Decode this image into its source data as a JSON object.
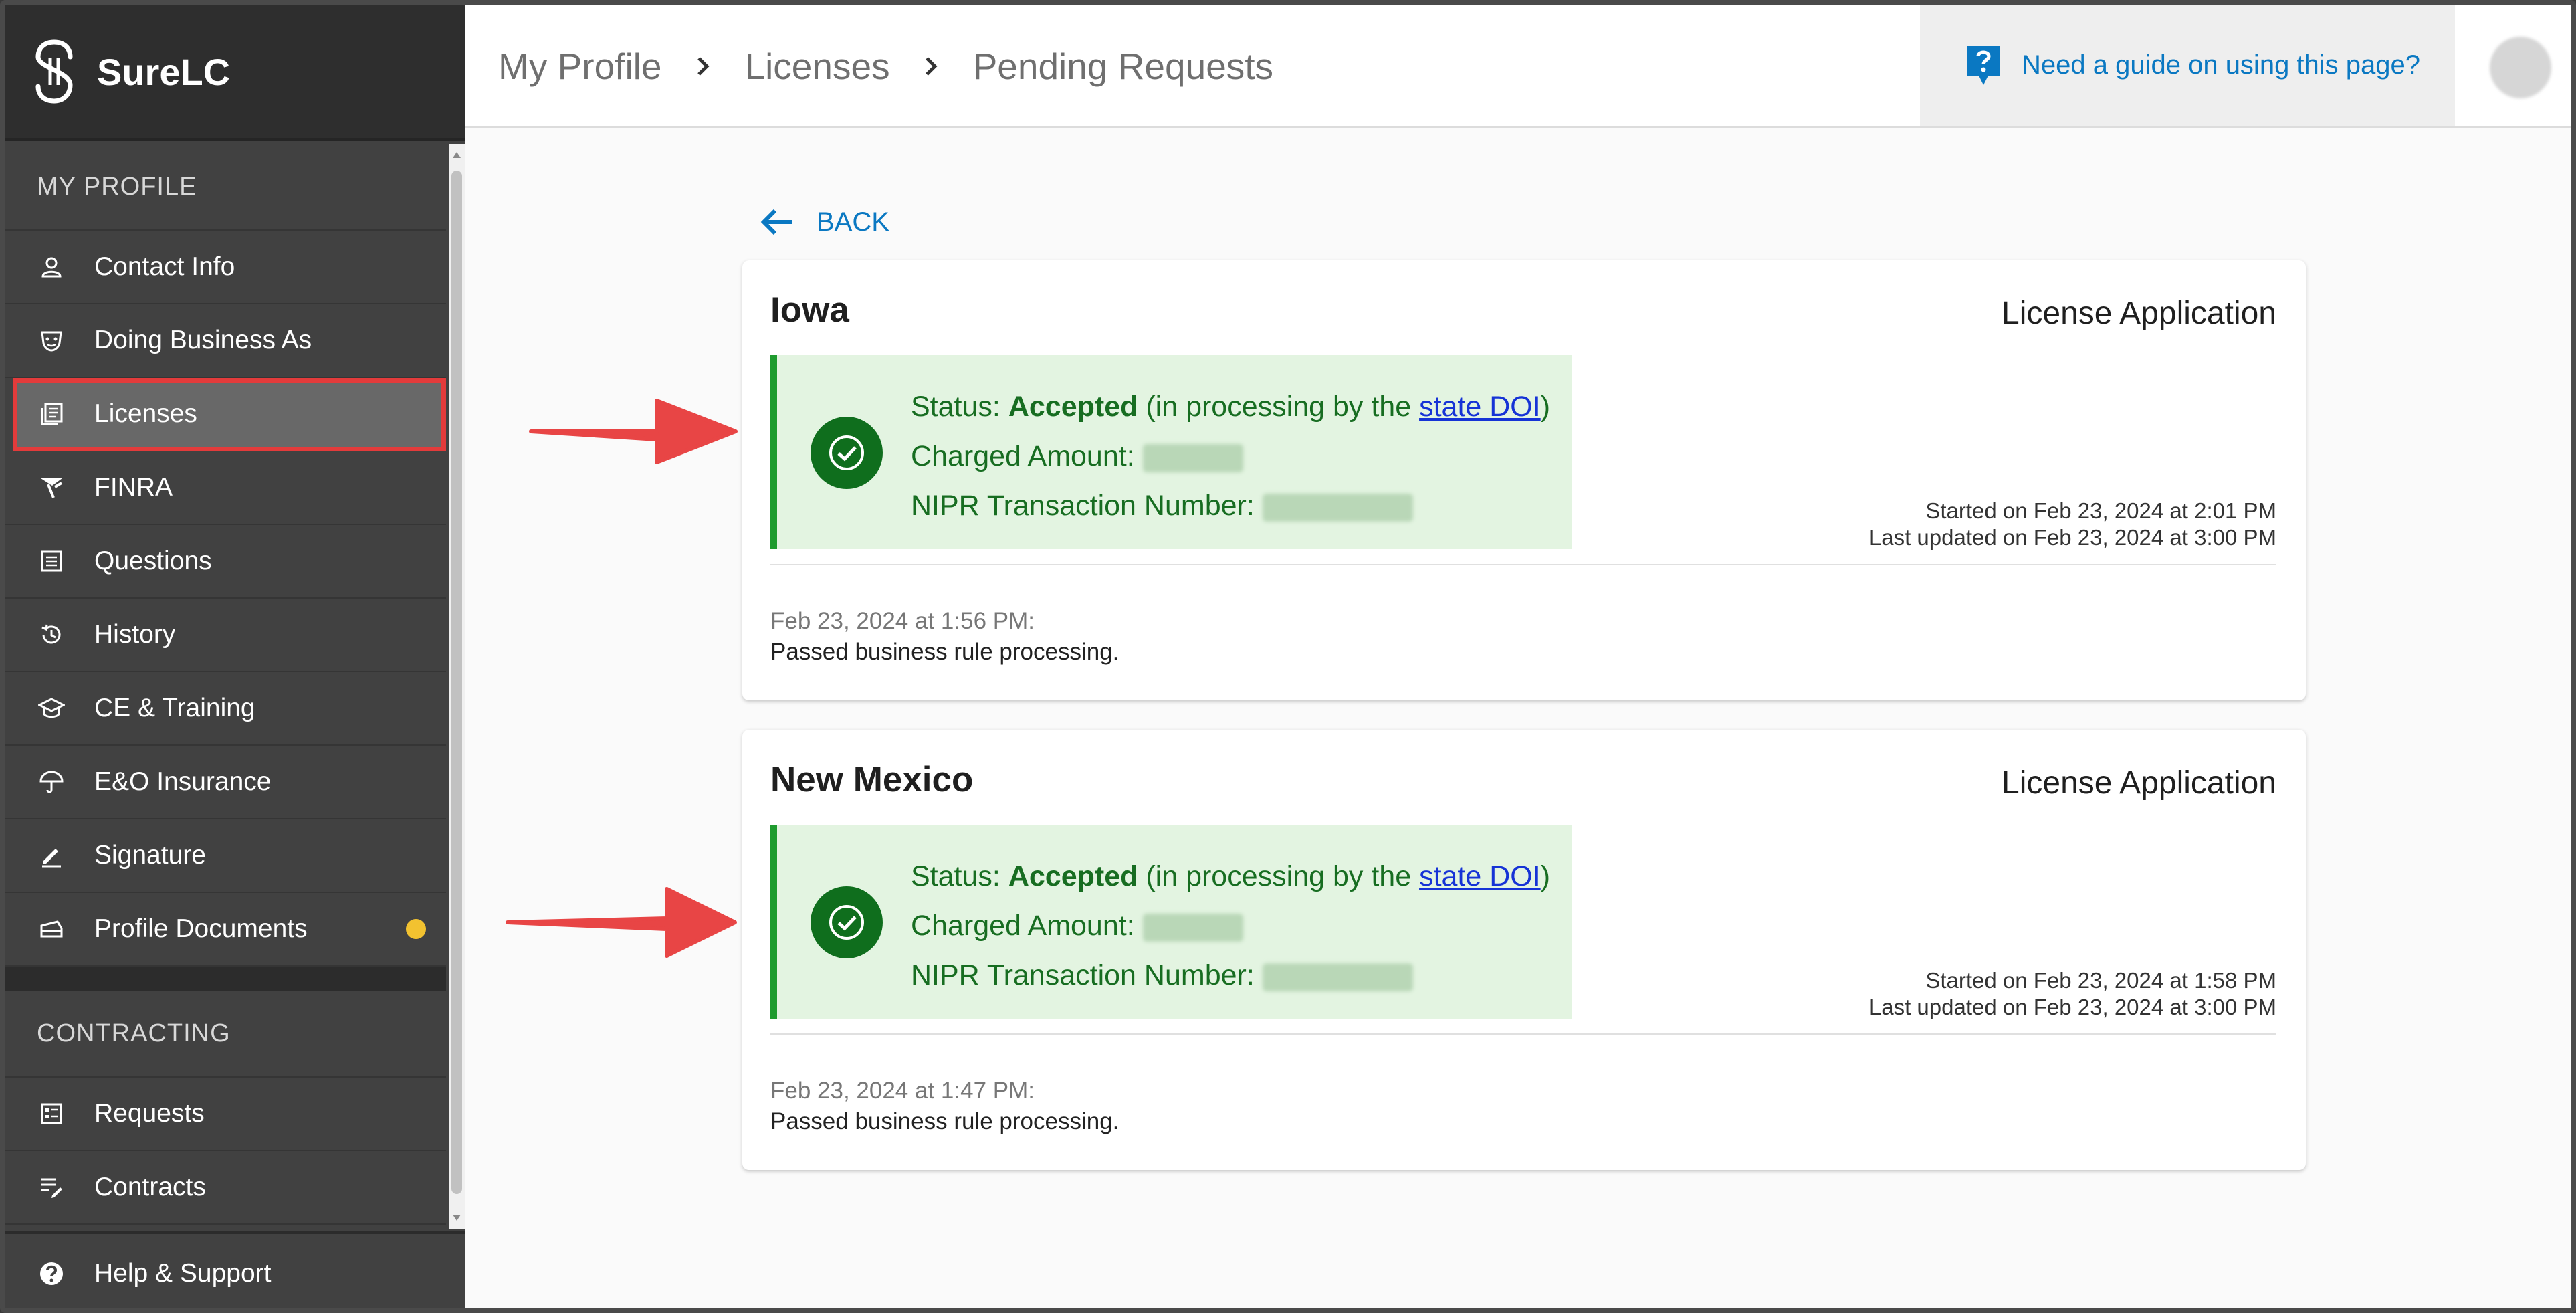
{
  "app": {
    "name": "SureLC"
  },
  "sidebar": {
    "sections": [
      {
        "title": "MY PROFILE",
        "items": [
          {
            "label": "Contact Info",
            "icon": "person-icon"
          },
          {
            "label": "Doing Business As",
            "icon": "mask-icon"
          },
          {
            "label": "Licenses",
            "icon": "license-icon",
            "active": true
          },
          {
            "label": "FINRA",
            "icon": "finra-icon"
          },
          {
            "label": "Questions",
            "icon": "questions-icon"
          },
          {
            "label": "History",
            "icon": "history-icon"
          },
          {
            "label": "CE & Training",
            "icon": "graduation-cap-icon"
          },
          {
            "label": "E&O Insurance",
            "icon": "umbrella-icon"
          },
          {
            "label": "Signature",
            "icon": "pen-icon"
          },
          {
            "label": "Profile Documents",
            "icon": "documents-icon",
            "badge_color": "#f2c230"
          }
        ]
      },
      {
        "title": "CONTRACTING",
        "items": [
          {
            "label": "Requests",
            "icon": "requests-icon"
          },
          {
            "label": "Contracts",
            "icon": "contracts-icon"
          }
        ]
      }
    ],
    "help": {
      "label": "Help & Support",
      "icon": "help-icon"
    }
  },
  "header": {
    "breadcrumbs": [
      "My Profile",
      "Licenses",
      "Pending Requests"
    ],
    "guide_link": "Need a guide on using this page?"
  },
  "main": {
    "back_label": "BACK",
    "requests": [
      {
        "state": "Iowa",
        "type": "License Application",
        "status_label": "Status:",
        "status_value": "Accepted",
        "status_note_prefix": "(in processing by the ",
        "status_link": "state DOI",
        "status_note_suffix": ")",
        "charged_label": "Charged Amount:",
        "nipr_label": "NIPR Transaction Number:",
        "started": "Started on Feb 23, 2024 at 2:01 PM",
        "updated": "Last updated on Feb 23, 2024 at 3:00 PM",
        "log_time": "Feb 23, 2024 at 1:56 PM:",
        "log_message": "Passed business rule processing."
      },
      {
        "state": "New Mexico",
        "type": "License Application",
        "status_label": "Status:",
        "status_value": "Accepted",
        "status_note_prefix": "(in processing by the ",
        "status_link": "state DOI",
        "status_note_suffix": ")",
        "charged_label": "Charged Amount:",
        "nipr_label": "NIPR Transaction Number:",
        "started": "Started on Feb 23, 2024 at 1:58 PM",
        "updated": "Last updated on Feb 23, 2024 at 3:00 PM",
        "log_time": "Feb 23, 2024 at 1:47 PM:",
        "log_message": "Passed business rule processing."
      }
    ]
  },
  "colors": {
    "accent": "#0a78c2",
    "highlight": "#e33b3b",
    "success": "#176d21",
    "success_bg": "#e3f4e1"
  }
}
